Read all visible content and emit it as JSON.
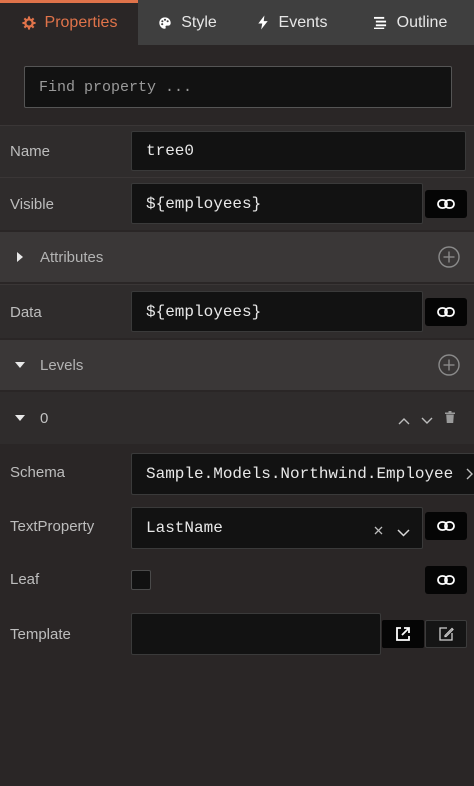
{
  "tabs": [
    {
      "label": "Properties",
      "icon": "gear-icon",
      "active": true
    },
    {
      "label": "Style",
      "icon": "palette-icon",
      "active": false
    },
    {
      "label": "Events",
      "icon": "lightning-icon",
      "active": false
    },
    {
      "label": "Outline",
      "icon": "list-icon",
      "active": false
    }
  ],
  "search": {
    "placeholder": "Find property ..."
  },
  "fields": {
    "name": {
      "label": "Name",
      "value": "tree0"
    },
    "visible": {
      "label": "Visible",
      "value": "${employees}"
    },
    "data": {
      "label": "Data",
      "value": "${employees}"
    }
  },
  "sections": {
    "attributes": {
      "title": "Attributes",
      "expanded": false
    },
    "levels": {
      "title": "Levels",
      "expanded": true
    }
  },
  "level": {
    "index": "0",
    "schema": {
      "label": "Schema",
      "value": "Sample.Models.Northwind.Employee"
    },
    "text_property": {
      "label": "TextProperty",
      "value": "LastName"
    },
    "leaf": {
      "label": "Leaf",
      "checked": false
    },
    "template": {
      "label": "Template",
      "value": ""
    }
  },
  "colors": {
    "accent": "#e0734a",
    "background": "#2a2626",
    "tabbar": "#3f3f3f"
  }
}
